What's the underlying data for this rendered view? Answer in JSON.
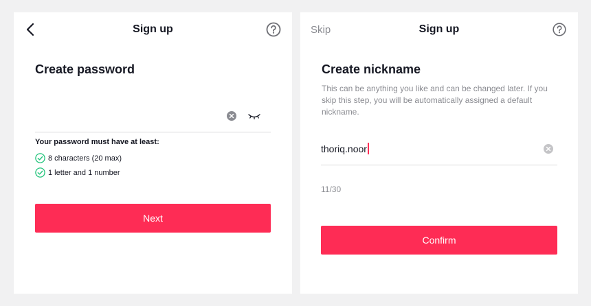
{
  "colors": {
    "accent": "#fe2c55",
    "check": "#20c37a",
    "muted": "#8a8b91",
    "background": "#f1f1f2"
  },
  "password_screen": {
    "header_title": "Sign up",
    "back_icon": "chevron-left-icon",
    "help_icon": "question-circle-icon",
    "title": "Create password",
    "password_value": "",
    "clear_icon": "clear-circle-icon",
    "visibility_icon": "eye-closed-icon",
    "requirements_title": "Your password must have at least:",
    "requirements": [
      {
        "label": "8 characters (20 max)",
        "met": true
      },
      {
        "label": "1 letter and 1 number",
        "met": true
      }
    ],
    "next_label": "Next"
  },
  "nickname_screen": {
    "skip_label": "Skip",
    "header_title": "Sign up",
    "help_icon": "question-circle-icon",
    "title": "Create nickname",
    "description": "This can be anything you like and can be changed later. If you skip this step, you will be automatically assigned a default nickname.",
    "nickname_value": "thoriq.noor",
    "clear_icon": "clear-circle-icon",
    "char_count": "11/30",
    "confirm_label": "Confirm"
  }
}
